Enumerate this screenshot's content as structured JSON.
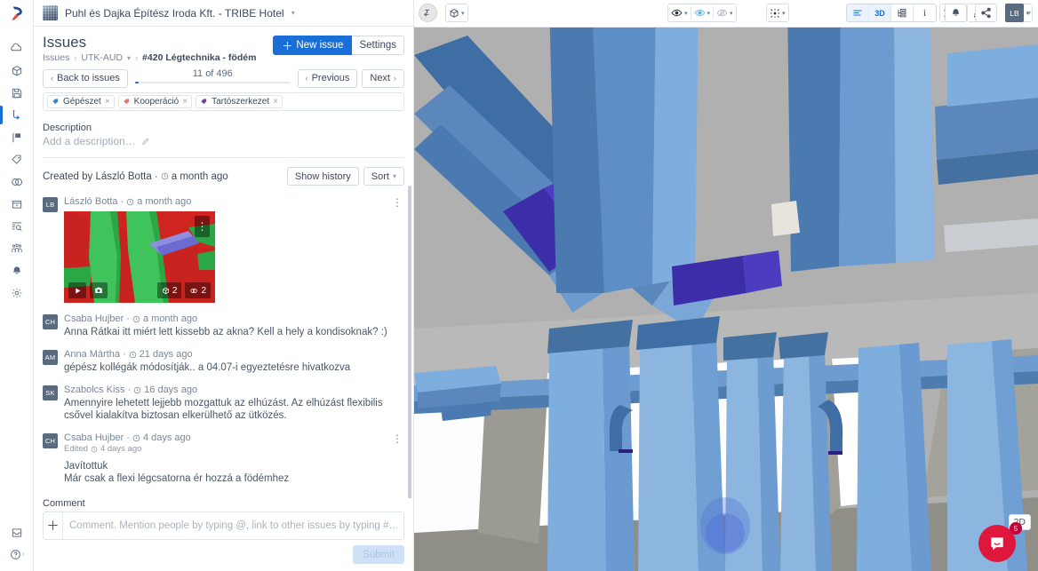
{
  "project": {
    "name": "Puhl és Dajka Építész Iroda Kft. - TRIBE Hotel",
    "thumb_icon": "building-thumbnail"
  },
  "rail": {
    "logo_icon": "bimcollab-logo",
    "items": [
      {
        "icon": "home-cloud-icon",
        "name": "sidebar-item-home",
        "active": false
      },
      {
        "icon": "cube-model-icon",
        "name": "sidebar-item-models",
        "active": false
      },
      {
        "icon": "save-disk-icon",
        "name": "sidebar-item-saved",
        "active": false
      },
      {
        "icon": "issues-flow-icon",
        "name": "sidebar-item-issues",
        "active": true
      },
      {
        "icon": "board-flag-icon",
        "name": "sidebar-item-board",
        "active": false
      },
      {
        "icon": "tag-label-icon",
        "name": "sidebar-item-labels",
        "active": false
      },
      {
        "icon": "clash-rings-icon",
        "name": "sidebar-item-clashes",
        "active": false
      },
      {
        "icon": "archive-box-icon",
        "name": "sidebar-item-archive",
        "active": false
      },
      {
        "icon": "inspect-search-icon",
        "name": "sidebar-item-inspect",
        "active": false
      },
      {
        "icon": "people-group-icon",
        "name": "sidebar-item-team",
        "active": false
      },
      {
        "icon": "bell-notify-icon",
        "name": "sidebar-item-notifications",
        "active": false
      },
      {
        "icon": "gear-settings-icon",
        "name": "sidebar-item-settings",
        "active": false
      }
    ],
    "bottom": [
      {
        "icon": "inbox-icon",
        "name": "rail-inbox"
      },
      {
        "icon": "help-circle-icon",
        "name": "rail-help"
      }
    ]
  },
  "issues": {
    "title": "Issues",
    "breadcrumb": {
      "root": "Issues",
      "project_code": "UTK-AUD",
      "current": "#420 Légtechnika - födém"
    },
    "new_issue_label": "New issue",
    "settings_label": "Settings",
    "back_label": "Back to issues",
    "counter": "11 of 496",
    "progress_percent": 2.2,
    "previous_label": "Previous",
    "next_label": "Next",
    "tags": [
      {
        "label": "Gépészet",
        "color": "#3e7fd1"
      },
      {
        "label": "Kooperáció",
        "color": "#e8776e"
      },
      {
        "label": "Tartószerkezet",
        "color": "#7c3fa0"
      }
    ]
  },
  "description": {
    "label": "Description",
    "placeholder": "Add a description…",
    "edit_icon": "pencil-icon"
  },
  "activity": {
    "created_by_text": "Created by László Botta ·",
    "created_time": "a month ago",
    "show_history_label": "Show history",
    "sort_label": "Sort",
    "comments": [
      {
        "initials": "LB",
        "author": "László Botta",
        "time": "a month ago",
        "text": "",
        "has_snapshot": true,
        "snapshot": {
          "play_icon": "play-icon",
          "camera_icon": "camera-icon",
          "models_count": "2",
          "clashes_count": "2"
        },
        "has_kebab": true
      },
      {
        "initials": "CH",
        "author": "Csaba Hujber",
        "time": "a month ago",
        "text": "Anna Rátkai itt miért lett kissebb az akna? Kell a hely a kondisoknak? :)",
        "has_snapshot": false,
        "has_kebab": false
      },
      {
        "initials": "AM",
        "author": "Anna Mártha",
        "time": "21 days ago",
        "text": "gépész kollégák módosítják.. a 04.07-i egyeztetésre hivatkozva",
        "has_snapshot": false,
        "has_kebab": false
      },
      {
        "initials": "SK",
        "author": "Szabolcs Kiss",
        "time": "16 days ago",
        "text": "Amennyire lehetett lejjebb mozgattuk az elhúzást. Az elhúzást flexibilis csővel kialakítva biztosan elkerülhető az ütközés.",
        "has_snapshot": false,
        "has_kebab": false
      },
      {
        "initials": "CH",
        "author": "Csaba Hujber",
        "time": "4 days ago",
        "edited_label": "Edited",
        "edited_time": "4 days ago",
        "text": "Javítottuk\nMár csak a flexi légcsatorna ér hozzá a födémhez",
        "has_snapshot": false,
        "has_kebab": true
      }
    ]
  },
  "comment_box": {
    "label": "Comment",
    "placeholder": "Comment. Mention people by typing @, link to other issues by typing #…",
    "add_icon": "plus-icon",
    "submit_label": "Submit"
  },
  "viewer": {
    "collapse_icon": "collapse-panel-icon",
    "mini_tools": [
      {
        "icon": "collapse-left-icon",
        "name": "viewer-collapse-arrow"
      },
      {
        "icon": "link-chain-icon",
        "name": "viewer-link-tool"
      },
      {
        "icon": "chart-bars-icon",
        "name": "viewer-measure-tool"
      }
    ],
    "left_tools": [
      {
        "icon": "cube-view-icon",
        "name": "viewer-view-cube",
        "caret": true
      }
    ],
    "center_tools": [
      {
        "icon": "eye-visible-icon",
        "name": "viewer-show-all",
        "caret": true,
        "state": "active"
      },
      {
        "icon": "eye-highlight-icon",
        "name": "viewer-isolate",
        "caret": true,
        "state": "blue"
      },
      {
        "icon": "eye-hidden-icon",
        "name": "viewer-hide",
        "caret": true,
        "state": "muted"
      },
      {
        "icon": "explode-icon",
        "name": "viewer-explode",
        "caret": true,
        "state": "normal"
      }
    ],
    "right_tools": [
      {
        "icon": "cursor-select-icon",
        "name": "viewer-select-mode",
        "caret": true
      },
      {
        "icon": "stamp-marker-icon",
        "name": "viewer-markup-tool",
        "caret": false
      },
      {
        "icon": "gear-settings-icon",
        "name": "viewer-settings",
        "caret": true
      }
    ],
    "btn_2d_label": "2D",
    "chat_badge": "5",
    "chat_icon": "chat-bubble-icon",
    "bg_color": "#b0b0b0"
  },
  "topright": {
    "views": [
      {
        "icon": "list-view-icon",
        "name": "view-toggle-list",
        "selected": true,
        "label": ""
      },
      {
        "icon": "3d-view-icon",
        "name": "view-toggle-3d",
        "selected": true,
        "label": "3D"
      },
      {
        "icon": "tree-view-icon",
        "name": "view-toggle-tree",
        "selected": false,
        "label": ""
      },
      {
        "icon": "info-view-icon",
        "name": "view-toggle-info",
        "selected": false,
        "label": "i"
      }
    ],
    "notification_icon": "bell-icon",
    "share_icon": "share-icon",
    "user_initials": "LB"
  }
}
